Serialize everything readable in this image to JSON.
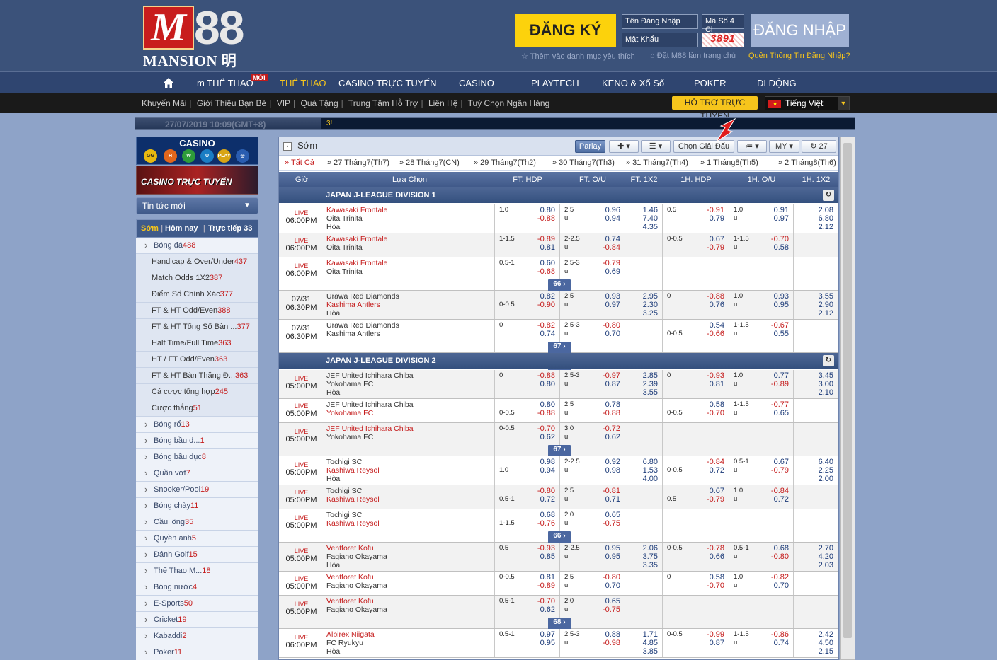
{
  "header": {
    "logo_sub": "MANSION 明陞",
    "register": "ĐĂNG KÝ",
    "username_placeholder": "Tên Đăng Nhập",
    "password_placeholder": "Mật Khẩu",
    "code_placeholder": "Mã Số 4 Cl",
    "captcha": "3891",
    "login": "ĐĂNG NHẬP",
    "fav": "Thêm vào danh mục yêu thích",
    "home": "Đặt M88 làm trang chủ",
    "forgot": "Quên Thông Tin Đăng Nhập?"
  },
  "nav": {
    "new_badge": "MỚI",
    "items": [
      "m THỂ THAO",
      "THỂ THAO",
      "CASINO TRỰC TUYẾN",
      "CASINO",
      "PLAYTECH",
      "KENO & Xổ Số",
      "POKER",
      "DI ĐỘNG"
    ]
  },
  "subnav": {
    "links": [
      "Khuyến Mãi",
      "Giới Thiệu Bạn Bè",
      "VIP",
      "Quà Tặng",
      "Trung Tâm Hỗ Trợ",
      "Liên Hệ",
      "Tuỳ Chọn Ngân Hàng"
    ],
    "support": "HỖ TRỢ TRỰC TUYẾN",
    "language": "Tiếng Việt"
  },
  "ticker": {
    "datetime": "27/07/2019 10:09(GMT+8)",
    "msg": "3!"
  },
  "sidebar": {
    "casino": "CASINO",
    "live_casino": "CASINO TRỰC TUYẾN",
    "news": "Tin tức mới",
    "tab_early": "Sớm",
    "tab_today": "Hôm nay",
    "tab_live": "Trực tiếp 33",
    "sports": [
      {
        "label": "Bóng đá",
        "count": "488",
        "type": "main"
      },
      {
        "label": "Handicap & Over/Under",
        "count": "437",
        "type": "sub"
      },
      {
        "label": "Match Odds 1X2",
        "count": "387",
        "type": "sub"
      },
      {
        "label": "Điểm Số Chính Xác",
        "count": "377",
        "type": "sub"
      },
      {
        "label": "FT & HT Odd/Even",
        "count": "388",
        "type": "sub"
      },
      {
        "label": "FT & HT Tổng Số Bàn ...",
        "count": "377",
        "type": "sub"
      },
      {
        "label": "Half Time/Full Time",
        "count": "363",
        "type": "sub"
      },
      {
        "label": "HT / FT Odd/Even",
        "count": "363",
        "type": "sub"
      },
      {
        "label": "FT & HT Bàn Thắng Đ...",
        "count": "363",
        "type": "sub"
      },
      {
        "label": "Cá cược tổng hợp",
        "count": "245",
        "type": "sub"
      },
      {
        "label": "Cược thắng",
        "count": "51",
        "type": "sub"
      },
      {
        "label": "Bóng rổ",
        "count": "13",
        "type": "main"
      },
      {
        "label": "Bóng bầu d...",
        "count": "1",
        "type": "main"
      },
      {
        "label": "Bóng bầu dục",
        "count": "8",
        "type": "main"
      },
      {
        "label": "Quần vợt",
        "count": "7",
        "type": "main"
      },
      {
        "label": "Snooker/Pool",
        "count": "19",
        "type": "main"
      },
      {
        "label": "Bóng chày",
        "count": "11",
        "type": "main"
      },
      {
        "label": "Cầu lông",
        "count": "35",
        "type": "main"
      },
      {
        "label": "Quyền anh",
        "count": "5",
        "type": "main"
      },
      {
        "label": "Đánh Golf",
        "count": "15",
        "type": "main"
      },
      {
        "label": "Thể Thao M...",
        "count": "18",
        "type": "main"
      },
      {
        "label": "Bóng nước",
        "count": "4",
        "type": "main"
      },
      {
        "label": "E-Sports",
        "count": "50",
        "type": "main"
      },
      {
        "label": "Cricket",
        "count": "19",
        "type": "main"
      },
      {
        "label": "Kabaddi",
        "count": "2",
        "type": "main"
      },
      {
        "label": "Poker",
        "count": "11",
        "type": "main"
      }
    ]
  },
  "toolbar": {
    "title": "Sớm",
    "parlay": "Parlay",
    "choose_league": "Chọn Giải Đấu",
    "odds_type": "MY",
    "refresh_count": "27"
  },
  "dates": [
    "» Tất Cả",
    "» 27 Tháng7(Th7)",
    "» 28 Tháng7(CN)",
    "» 29 Tháng7(Th2)",
    "» 30 Tháng7(Th3)",
    "» 31 Tháng7(Th4)",
    "» 1 Tháng8(Th5)",
    "» 2 Tháng8(Th6)"
  ],
  "columns": [
    "Giờ",
    "Lựa Chọn",
    "FT. HDP",
    "FT. O/U",
    "FT. 1X2",
    "1H. HDP",
    "1H. O/U",
    "1H. 1X2"
  ],
  "leagues": [
    "JAPAN J-LEAGUE DIVISION 1",
    "JAPAN J-LEAGUE DIVISION 2"
  ],
  "rows": [
    {
      "live": "LIVE",
      "time": "06:00PM",
      "teams": [
        "Kawasaki Frontale",
        "Oita Trinita",
        "Hòa"
      ],
      "red": [
        0
      ],
      "fh": {
        "line": "1.0",
        "row": 0,
        "o": [
          "0.80",
          "-0.88"
        ]
      },
      "fo": {
        "line": "2.5",
        "o": [
          "0.96",
          "0.94"
        ]
      },
      "fx": [
        "1.46",
        "7.40",
        "4.35"
      ],
      "hh": {
        "line": "0.5",
        "row": 0,
        "o": [
          "-0.91",
          "0.79"
        ]
      },
      "ho": {
        "line": "1.0",
        "o": [
          "0.91",
          "0.97"
        ]
      },
      "hx": [
        "2.08",
        "6.80",
        "2.12"
      ]
    },
    {
      "live": "LIVE",
      "time": "06:00PM",
      "teams": [
        "Kawasaki Frontale",
        "Oita Trinita"
      ],
      "red": [
        0
      ],
      "fh": {
        "line": "1-1.5",
        "row": 0,
        "o": [
          "-0.89",
          "0.81"
        ]
      },
      "fo": {
        "line": "2-2.5",
        "o": [
          "0.74",
          "-0.84"
        ]
      },
      "fx": [],
      "hh": {
        "line": "0-0.5",
        "row": 0,
        "o": [
          "0.67",
          "-0.79"
        ]
      },
      "ho": {
        "line": "1-1.5",
        "o": [
          "-0.70",
          "0.58"
        ]
      },
      "hx": []
    },
    {
      "live": "LIVE",
      "time": "06:00PM",
      "teams": [
        "Kawasaki Frontale",
        "Oita Trinita"
      ],
      "red": [
        0
      ],
      "fh": {
        "line": "0.5-1",
        "row": 0,
        "o": [
          "0.60",
          "-0.68"
        ]
      },
      "fo": {
        "line": "2.5-3",
        "o": [
          "-0.79",
          "0.69"
        ]
      },
      "fx": [],
      "hh": null,
      "ho": null,
      "hx": [],
      "more": "66"
    },
    {
      "live": "",
      "time": "07/31 06:30PM",
      "teams": [
        "Urawa Red Diamonds",
        "Kashima Antlers",
        "Hòa"
      ],
      "red": [
        1
      ],
      "fh": {
        "line": "0-0.5",
        "row": 1,
        "o": [
          "0.82",
          "-0.90"
        ]
      },
      "fo": {
        "line": "2.5",
        "o": [
          "0.93",
          "0.97"
        ]
      },
      "fx": [
        "2.95",
        "2.30",
        "3.25"
      ],
      "hh": {
        "line": "0",
        "row": 0,
        "o": [
          "-0.88",
          "0.76"
        ]
      },
      "ho": {
        "line": "1.0",
        "o": [
          "0.93",
          "0.95"
        ]
      },
      "hx": [
        "3.55",
        "2.90",
        "2.12"
      ]
    },
    {
      "live": "",
      "time": "07/31 06:30PM",
      "teams": [
        "Urawa Red Diamonds",
        "Kashima Antlers"
      ],
      "red": [],
      "fh": {
        "line": "0",
        "row": 0,
        "o": [
          "-0.82",
          "0.74"
        ]
      },
      "fo": {
        "line": "2.5-3",
        "o": [
          "-0.80",
          "0.70"
        ]
      },
      "fx": [],
      "hh": {
        "line": "0-0.5",
        "row": 1,
        "o": [
          "0.54",
          "-0.66"
        ]
      },
      "ho": {
        "line": "1-1.5",
        "o": [
          "-0.67",
          "0.55"
        ]
      },
      "hx": [],
      "more": "67"
    },
    {
      "live": "LIVE",
      "time": "05:00PM",
      "teams": [
        "JEF United Ichihara Chiba",
        "Yokohama FC",
        "Hòa"
      ],
      "red": [],
      "fh": {
        "line": "0",
        "row": 0,
        "o": [
          "-0.88",
          "0.80"
        ]
      },
      "fo": {
        "line": "2.5-3",
        "o": [
          "-0.97",
          "0.87"
        ]
      },
      "fx": [
        "2.85",
        "2.39",
        "3.55"
      ],
      "hh": {
        "line": "0",
        "row": 0,
        "o": [
          "-0.93",
          "0.81"
        ]
      },
      "ho": {
        "line": "1.0",
        "o": [
          "0.77",
          "-0.89"
        ]
      },
      "hx": [
        "3.45",
        "3.00",
        "2.10"
      ]
    },
    {
      "live": "LIVE",
      "time": "05:00PM",
      "teams": [
        "JEF United Ichihara Chiba",
        "Yokohama FC"
      ],
      "red": [
        1
      ],
      "fh": {
        "line": "0-0.5",
        "row": 1,
        "o": [
          "0.80",
          "-0.88"
        ]
      },
      "fo": {
        "line": "2.5",
        "o": [
          "0.78",
          "-0.88"
        ]
      },
      "fx": [],
      "hh": {
        "line": "0-0.5",
        "row": 1,
        "o": [
          "0.58",
          "-0.70"
        ]
      },
      "ho": {
        "line": "1-1.5",
        "o": [
          "-0.77",
          "0.65"
        ]
      },
      "hx": []
    },
    {
      "live": "LIVE",
      "time": "05:00PM",
      "teams": [
        "JEF United Ichihara Chiba",
        "Yokohama FC"
      ],
      "red": [
        0
      ],
      "fh": {
        "line": "0-0.5",
        "row": 0,
        "o": [
          "-0.70",
          "0.62"
        ]
      },
      "fo": {
        "line": "3.0",
        "o": [
          "-0.72",
          "0.62"
        ]
      },
      "fx": [],
      "hh": null,
      "ho": null,
      "hx": [],
      "more": "67"
    },
    {
      "live": "LIVE",
      "time": "05:00PM",
      "teams": [
        "Tochigi SC",
        "Kashiwa Reysol",
        "Hòa"
      ],
      "red": [
        1
      ],
      "fh": {
        "line": "1.0",
        "row": 1,
        "o": [
          "0.98",
          "0.94"
        ]
      },
      "fo": {
        "line": "2-2.5",
        "o": [
          "0.92",
          "0.98"
        ]
      },
      "fx": [
        "6.80",
        "1.53",
        "4.00"
      ],
      "hh": {
        "line": "0-0.5",
        "row": 1,
        "o": [
          "-0.84",
          "0.72"
        ]
      },
      "ho": {
        "line": "0.5-1",
        "o": [
          "0.67",
          "-0.79"
        ]
      },
      "hx": [
        "6.40",
        "2.25",
        "2.00"
      ]
    },
    {
      "live": "LIVE",
      "time": "05:00PM",
      "teams": [
        "Tochigi SC",
        "Kashiwa Reysol"
      ],
      "red": [
        1
      ],
      "fh": {
        "line": "0.5-1",
        "row": 1,
        "o": [
          "-0.80",
          "0.72"
        ]
      },
      "fo": {
        "line": "2.5",
        "o": [
          "-0.81",
          "0.71"
        ]
      },
      "fx": [],
      "hh": {
        "line": "0.5",
        "row": 1,
        "o": [
          "0.67",
          "-0.79"
        ]
      },
      "ho": {
        "line": "1.0",
        "o": [
          "-0.84",
          "0.72"
        ]
      },
      "hx": []
    },
    {
      "live": "LIVE",
      "time": "05:00PM",
      "teams": [
        "Tochigi SC",
        "Kashiwa Reysol"
      ],
      "red": [
        1
      ],
      "fh": {
        "line": "1-1.5",
        "row": 1,
        "o": [
          "0.68",
          "-0.76"
        ]
      },
      "fo": {
        "line": "2.0",
        "o": [
          "0.65",
          "-0.75"
        ]
      },
      "fx": [],
      "hh": null,
      "ho": null,
      "hx": [],
      "more": "66"
    },
    {
      "live": "LIVE",
      "time": "05:00PM",
      "teams": [
        "Ventforet Kofu",
        "Fagiano Okayama",
        "Hòa"
      ],
      "red": [
        0
      ],
      "fh": {
        "line": "0.5",
        "row": 0,
        "o": [
          "-0.93",
          "0.85"
        ]
      },
      "fo": {
        "line": "2-2.5",
        "o": [
          "0.95",
          "0.95"
        ]
      },
      "fx": [
        "2.06",
        "3.75",
        "3.35"
      ],
      "hh": {
        "line": "0-0.5",
        "row": 0,
        "o": [
          "-0.78",
          "0.66"
        ]
      },
      "ho": {
        "line": "0.5-1",
        "o": [
          "0.68",
          "-0.80"
        ]
      },
      "hx": [
        "2.70",
        "4.20",
        "2.03"
      ]
    },
    {
      "live": "LIVE",
      "time": "05:00PM",
      "teams": [
        "Ventforet Kofu",
        "Fagiano Okayama"
      ],
      "red": [
        0
      ],
      "fh": {
        "line": "0-0.5",
        "row": 0,
        "o": [
          "0.81",
          "-0.89"
        ]
      },
      "fo": {
        "line": "2.5",
        "o": [
          "-0.80",
          "0.70"
        ]
      },
      "fx": [],
      "hh": {
        "line": "0",
        "row": 0,
        "o": [
          "0.58",
          "-0.70"
        ]
      },
      "ho": {
        "line": "1.0",
        "o": [
          "-0.82",
          "0.70"
        ]
      },
      "hx": []
    },
    {
      "live": "LIVE",
      "time": "05:00PM",
      "teams": [
        "Ventforet Kofu",
        "Fagiano Okayama"
      ],
      "red": [
        0
      ],
      "fh": {
        "line": "0.5-1",
        "row": 0,
        "o": [
          "-0.70",
          "0.62"
        ]
      },
      "fo": {
        "line": "2.0",
        "o": [
          "0.65",
          "-0.75"
        ]
      },
      "fx": [],
      "hh": null,
      "ho": null,
      "hx": [],
      "more": "68"
    },
    {
      "live": "LIVE",
      "time": "06:00PM",
      "teams": [
        "Albirex Niigata",
        "FC Ryukyu",
        "Hòa"
      ],
      "red": [
        0
      ],
      "fh": {
        "line": "0.5-1",
        "row": 0,
        "o": [
          "0.97",
          "0.95"
        ]
      },
      "fo": {
        "line": "2.5-3",
        "o": [
          "0.88",
          "-0.98"
        ]
      },
      "fx": [
        "1.71",
        "4.85",
        "3.85"
      ],
      "hh": {
        "line": "0-0.5",
        "row": 0,
        "o": [
          "-0.99",
          "0.87"
        ]
      },
      "ho": {
        "line": "1-1.5",
        "o": [
          "-0.86",
          "0.74"
        ]
      },
      "hx": [
        "2.42",
        "4.50",
        "2.15"
      ]
    }
  ]
}
